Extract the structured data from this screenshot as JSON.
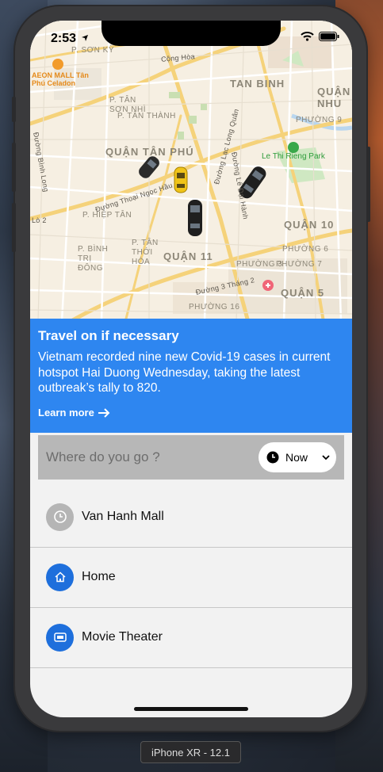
{
  "status_bar": {
    "time": "2:53"
  },
  "map": {
    "districts": [
      "TAN BINH",
      "QUẬN TÂN PHÚ",
      "QUẬN 11",
      "QUẬN 10",
      "QUẬN 5",
      "QUẬN NHU"
    ],
    "wards": [
      "P. SƠN KỲ",
      "P. TÂN SƠN NHÌ",
      "P. TÂN THÀNH",
      "P. HIỆP TÂN",
      "P. TÂN THỚI HÒA",
      "P. BÌNH TRỊ ĐÔNG",
      "PHƯỜNG 3",
      "PHƯỜNG 6",
      "PHƯỜNG 7",
      "PHƯỜNG 16",
      "PHƯỜNG 9"
    ],
    "roads": [
      "Cộng Hòa",
      "Đường Thoại Ngọc Hầu",
      "Đường Lạc Long Quân",
      "Đường 3 Tháng 2",
      "Đường Bình Long",
      "Đường Lê Đại Hành",
      "Lò 2"
    ],
    "pois": {
      "mall": "AEON MALL Tân Phú Celadon",
      "park": "Le Thi Rieng Park"
    }
  },
  "banner": {
    "title": "Travel on if necessary",
    "body": "Vietnam recorded nine new Covid-19 cases in current hotspot Hai Duong Wednesday, taking the latest outbreak’s tally to 820.",
    "link": "Learn more"
  },
  "search": {
    "placeholder": "Where do you go ?",
    "time_label": "Now"
  },
  "destinations": [
    {
      "label": "Van Hanh Mall",
      "icon": "clock-icon",
      "color": "#b5b5b5"
    },
    {
      "label": "Home",
      "icon": "home-icon",
      "color": "#1e6fdc"
    },
    {
      "label": "Movie Theater",
      "icon": "ticket-icon",
      "color": "#1e6fdc"
    }
  ],
  "device": {
    "label": "iPhone XR - 12.1"
  },
  "colors": {
    "banner": "#2e86f0",
    "accent": "#1e6fdc",
    "search_bg": "#b7b7b7"
  }
}
